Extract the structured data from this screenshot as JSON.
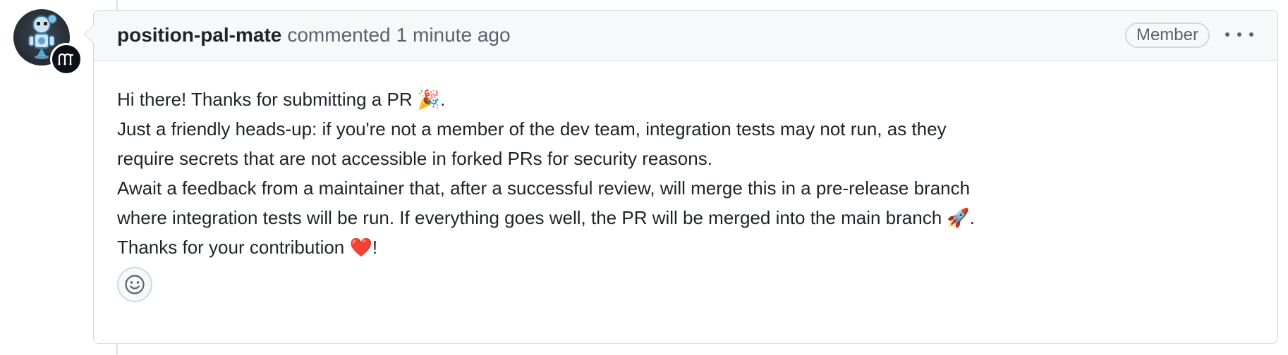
{
  "comment": {
    "author": "position-pal-mate",
    "action": "commented",
    "timestamp": "1 minute ago",
    "role_badge": "Member",
    "avatar_icon": "robot-avatar-icon",
    "badge_icon": "app-bot-badge-icon",
    "more_options_icon": "kebab-horizontal-icon",
    "reaction_icon": "smiley-icon",
    "body_lines": [
      "Hi there! Thanks for submitting a PR 🎉.",
      "Just a friendly heads-up: if you're not a member of the dev team, integration tests may not run, as they",
      "require secrets that are not accessible in forked PRs for security reasons.",
      "Await a feedback from a maintainer that, after a successful review, will merge this in a pre-release branch",
      "where integration tests will be run. If everything goes well, the PR will be merged into the main branch 🚀.",
      "Thanks for your contribution ❤️!"
    ]
  },
  "colors": {
    "border": "#d1d9e0",
    "header_bg": "#f6f8fa",
    "muted_text": "#59636e",
    "text": "#1f2328"
  }
}
